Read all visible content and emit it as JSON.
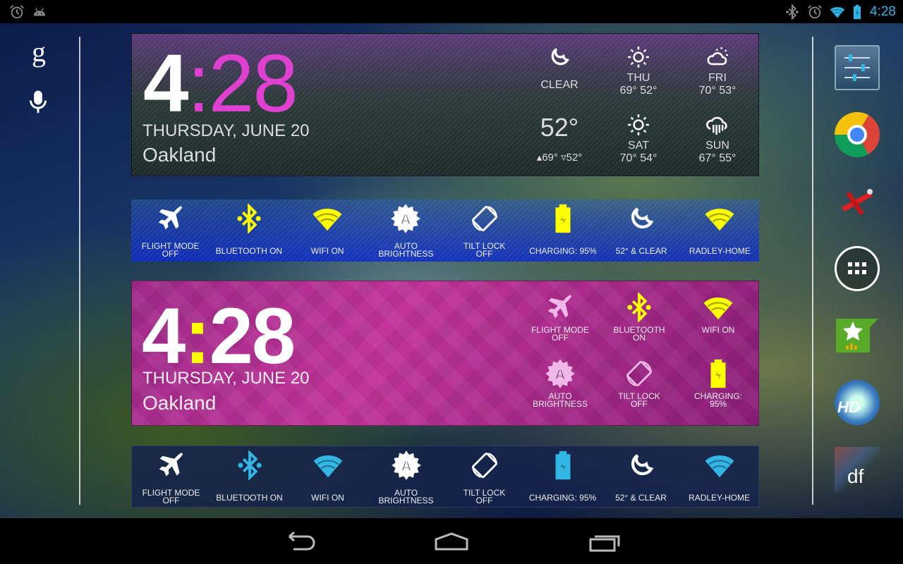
{
  "status_bar": {
    "time": "4:28",
    "left_icons": [
      "alarm-icon",
      "android-icon"
    ],
    "right_icons": [
      "bluetooth-icon",
      "alarm-icon",
      "wifi-icon",
      "battery-charging-icon"
    ],
    "accent": "#33b5e5"
  },
  "left_rail": {
    "icons": [
      "google-search-icon",
      "voice-search-icon"
    ],
    "google_letter": "g"
  },
  "widget_weather": {
    "hour": "4",
    "colon": ":",
    "minutes": "28",
    "date": "THURSDAY, JUNE 20",
    "city": "Oakland",
    "minute_color": "#e040d0",
    "current": {
      "condition": "CLEAR",
      "temp": "52°",
      "high": "69°",
      "low": "52°",
      "icon": "moon-icon"
    },
    "forecast": [
      {
        "day": "THU",
        "temps": "69° 52°",
        "icon": "sun-icon"
      },
      {
        "day": "FRI",
        "temps": "70° 53°",
        "icon": "partly-cloudy-icon"
      },
      {
        "day": "SAT",
        "temps": "70° 54°",
        "icon": "sun-icon"
      },
      {
        "day": "SUN",
        "temps": "67° 55°",
        "icon": "rain-icon"
      }
    ]
  },
  "toggle_bar_1": {
    "color": "#ffff00",
    "items": [
      {
        "l1": "FLIGHT MODE",
        "l2": "OFF",
        "icon": "airplane-icon"
      },
      {
        "l1": "BLUETOOTH ON",
        "l2": "",
        "icon": "bluetooth-icon"
      },
      {
        "l1": "WIFI ON",
        "l2": "",
        "icon": "wifi-icon"
      },
      {
        "l1": "AUTO",
        "l2": "BRIGHTNESS",
        "icon": "auto-brightness-icon"
      },
      {
        "l1": "TILT LOCK",
        "l2": "OFF",
        "icon": "rotate-icon"
      },
      {
        "l1": "CHARGING: 95%",
        "l2": "",
        "icon": "battery-icon"
      },
      {
        "l1": "52° & CLEAR",
        "l2": "",
        "icon": "moon-icon"
      },
      {
        "l1": "RADLEY-HOME",
        "l2": "",
        "icon": "wifi-icon"
      }
    ]
  },
  "widget_pink": {
    "hour": "4",
    "colon": ":",
    "minutes": "28",
    "date": "THURSDAY, JUNE 20",
    "city": "Oakland",
    "colon_color": "#ffff00",
    "items": [
      {
        "l1": "FLIGHT MODE",
        "l2": "OFF",
        "icon": "airplane-icon"
      },
      {
        "l1": "BLUETOOTH",
        "l2": "ON",
        "icon": "bluetooth-icon"
      },
      {
        "l1": "WIFI ON",
        "l2": "",
        "icon": "wifi-icon"
      },
      {
        "l1": "AUTO",
        "l2": "BRIGHTNESS",
        "icon": "auto-brightness-icon"
      },
      {
        "l1": "TILT LOCK",
        "l2": "OFF",
        "icon": "rotate-icon"
      },
      {
        "l1": "CHARGING:",
        "l2": "95%",
        "icon": "battery-icon"
      }
    ]
  },
  "toggle_bar_3": {
    "color": "#33b5e5",
    "items": [
      {
        "l1": "FLIGHT MODE",
        "l2": "OFF",
        "icon": "airplane-icon"
      },
      {
        "l1": "BLUETOOTH ON",
        "l2": "",
        "icon": "bluetooth-icon"
      },
      {
        "l1": "WIFI ON",
        "l2": "",
        "icon": "wifi-icon"
      },
      {
        "l1": "AUTO",
        "l2": "BRIGHTNESS",
        "icon": "auto-brightness-icon"
      },
      {
        "l1": "TILT LOCK",
        "l2": "OFF",
        "icon": "rotate-icon"
      },
      {
        "l1": "CHARGING: 95%",
        "l2": "",
        "icon": "battery-icon"
      },
      {
        "l1": "52° & CLEAR",
        "l2": "",
        "icon": "moon-icon"
      },
      {
        "l1": "RADLEY-HOME",
        "l2": "",
        "icon": "wifi-icon"
      }
    ]
  },
  "dock": {
    "apps": [
      "settings-app-icon",
      "chrome-app-icon",
      "plane-game-app-icon",
      "all-apps-icon",
      "star-app-icon",
      "hd-widgets-app-icon",
      "df-app-icon"
    ],
    "df_label": "df",
    "hd_label": "HD"
  },
  "nav_bar": {
    "buttons": [
      "back-icon",
      "home-icon",
      "recents-icon"
    ]
  }
}
